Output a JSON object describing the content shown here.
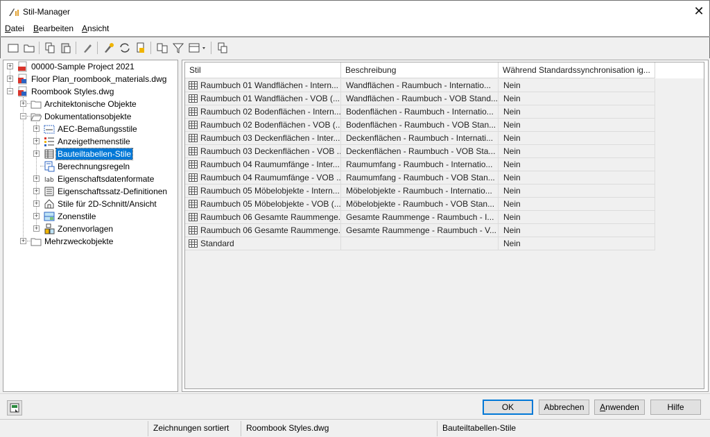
{
  "window": {
    "title": "Stil-Manager",
    "close_glyph": "✕",
    "icon": "style-manager-icon"
  },
  "menu": [
    {
      "first": "D",
      "rest": "atei"
    },
    {
      "first": "B",
      "rest": "earbeiten"
    },
    {
      "first": "A",
      "rest": "nsicht"
    }
  ],
  "tree": {
    "nodes": [
      {
        "label": "00000-Sample Project 2021",
        "icon": "project-pdf-icon"
      },
      {
        "label": "Floor Plan_roombook_materials.dwg",
        "icon": "dwg-file-icon"
      },
      {
        "label": "Roombook Styles.dwg",
        "icon": "dwg-file-icon"
      },
      {
        "label": "Architektonische Objekte",
        "icon": "folder-icon"
      },
      {
        "label": "Dokumentationsobjekte",
        "icon": "folder-open-icon"
      },
      {
        "label": "AEC-Bemaßungsstile",
        "icon": "dimension-style-icon"
      },
      {
        "label": "Anzeigethemenstile",
        "icon": "display-theme-icon"
      },
      {
        "label": "Bauteiltabellen-Stile",
        "icon": "schedule-table-icon"
      },
      {
        "label": "Berechnungsregeln",
        "icon": "calculation-rule-icon"
      },
      {
        "label": "Eigenschaftsdatenformate",
        "icon": "property-format-icon"
      },
      {
        "label": "Eigenschaftssatz-Definitionen",
        "icon": "property-set-icon"
      },
      {
        "label": "Stile für 2D-Schnitt/Ansicht",
        "icon": "section-view-icon"
      },
      {
        "label": "Zonenstile",
        "icon": "zone-style-icon"
      },
      {
        "label": "Zonenvorlagen",
        "icon": "zone-template-icon"
      },
      {
        "label": "Mehrzweckobjekte",
        "icon": "folder-icon"
      }
    ]
  },
  "grid": {
    "columns": [
      "Stil",
      "Beschreibung",
      "Während Standardssynchronisation ig..."
    ],
    "rows": [
      {
        "stil": "Raumbuch 01 Wandflächen - Intern...",
        "beschreibung": "Wandflächen - Raumbuch - Internatio...",
        "ignore": "Nein"
      },
      {
        "stil": "Raumbuch 01 Wandflächen - VOB (...",
        "beschreibung": "Wandflächen - Raumbuch - VOB Stand...",
        "ignore": "Nein"
      },
      {
        "stil": "Raumbuch 02 Bodenflächen - Intern...",
        "beschreibung": "Bodenflächen - Raumbuch - Internatio...",
        "ignore": "Nein"
      },
      {
        "stil": "Raumbuch 02 Bodenflächen - VOB (...",
        "beschreibung": "Bodenflächen - Raumbuch - VOB Stan...",
        "ignore": "Nein"
      },
      {
        "stil": "Raumbuch 03 Deckenflächen - Inter...",
        "beschreibung": "Deckenflächen - Raumbuch - Internati...",
        "ignore": "Nein"
      },
      {
        "stil": "Raumbuch 03 Deckenflächen - VOB ...",
        "beschreibung": "Deckenflächen - Raumbuch - VOB Sta...",
        "ignore": "Nein"
      },
      {
        "stil": "Raumbuch 04 Raumumfänge - Inter...",
        "beschreibung": "Raumumfang - Raumbuch - Internatio...",
        "ignore": "Nein"
      },
      {
        "stil": "Raumbuch 04 Raumumfänge - VOB ...",
        "beschreibung": "Raumumfang - Raumbuch - VOB Stan...",
        "ignore": "Nein"
      },
      {
        "stil": "Raumbuch 05 Möbelobjekte - Intern...",
        "beschreibung": "Möbelobjekte - Raumbuch - Internatio...",
        "ignore": "Nein"
      },
      {
        "stil": "Raumbuch 05 Möbelobjekte - VOB (...",
        "beschreibung": "Möbelobjekte - Raumbuch - VOB Stan...",
        "ignore": "Nein"
      },
      {
        "stil": "Raumbuch 06 Gesamte Raummenge...",
        "beschreibung": "Gesamte Raummenge - Raumbuch - I...",
        "ignore": "Nein"
      },
      {
        "stil": "Raumbuch 06 Gesamte Raummenge...",
        "beschreibung": "Gesamte Raummenge - Raumbuch - V...",
        "ignore": "Nein"
      },
      {
        "stil": "Standard",
        "beschreibung": "",
        "ignore": "Nein"
      }
    ]
  },
  "buttons": {
    "ok": "OK",
    "cancel": "Abbrechen",
    "apply_first": "A",
    "apply_rest": "nwenden",
    "help": "Hilfe"
  },
  "status": {
    "sort": "Zeichnungen sortiert",
    "drawing": "Roombook Styles.dwg",
    "category": "Bauteiltabellen-Stile"
  },
  "colors": {
    "selection": "#0078d7",
    "ok_border": "#0078d7",
    "pdf_red": "#d9342b",
    "folder": "#e8c46a"
  }
}
